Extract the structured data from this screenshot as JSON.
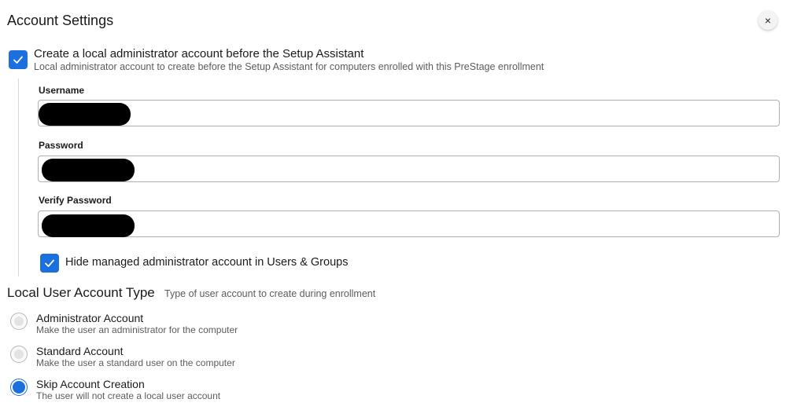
{
  "header": {
    "title": "Account Settings",
    "close_icon": "×"
  },
  "admin_account": {
    "checked": true,
    "label": "Create a local administrator account before the Setup Assistant",
    "description": "Local administrator account to create before the Setup Assistant for computers enrolled with this PreStage enrollment",
    "fields": {
      "username_label": "Username",
      "password_label": "Password",
      "verify_password_label": "Verify Password"
    },
    "hide_checkbox": {
      "checked": true,
      "label": "Hide managed administrator account in Users & Groups"
    }
  },
  "local_user_type": {
    "title": "Local User Account Type",
    "description": "Type of user account to create during enrollment",
    "options": [
      {
        "title": "Administrator Account",
        "description": "Make the user an administrator for the computer",
        "selected": false
      },
      {
        "title": "Standard Account",
        "description": "Make the user a standard user on the computer",
        "selected": false
      },
      {
        "title": "Skip Account Creation",
        "description": "The user will not create a local user account",
        "selected": true
      }
    ]
  },
  "colors": {
    "accent": "#1b6fde",
    "border": "#b0b0b0",
    "muted_text": "#5c5c5c"
  },
  "icons": {
    "close": "close-icon",
    "check": "checkmark-icon"
  }
}
